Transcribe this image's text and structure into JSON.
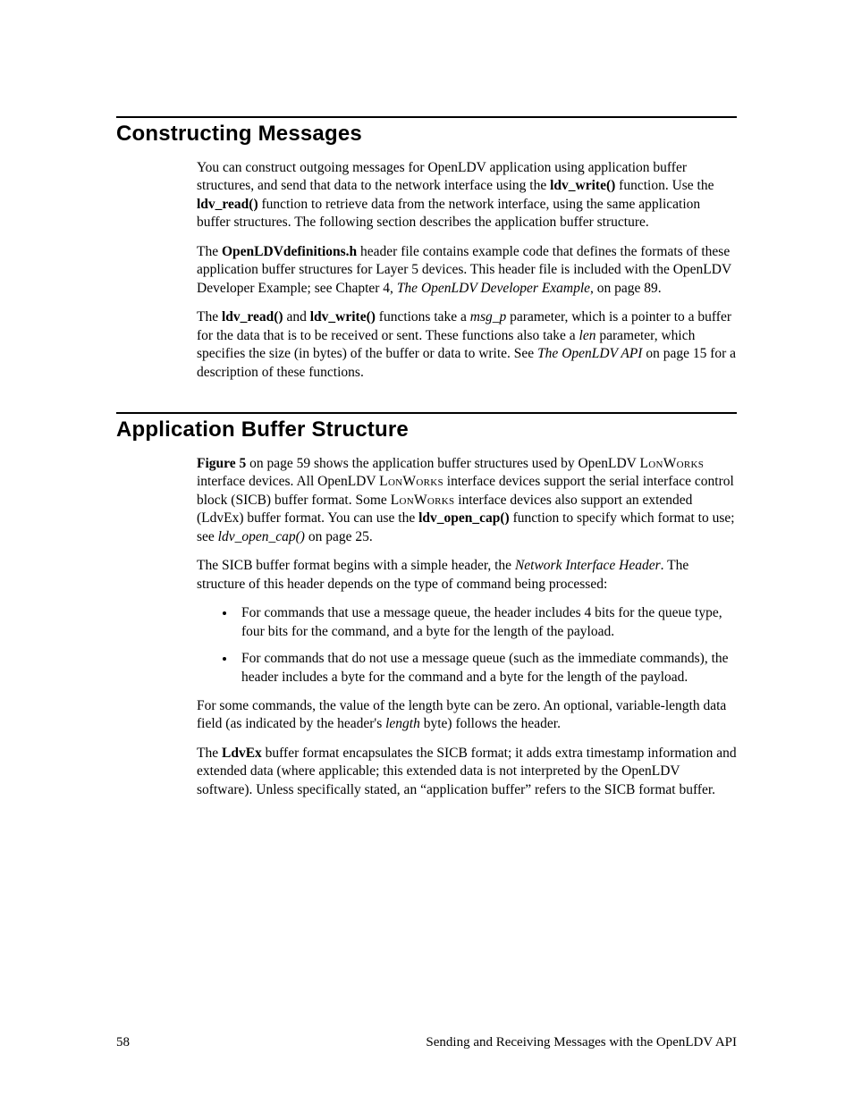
{
  "page_number": "58",
  "footer_text": "Sending and Receiving Messages with the OpenLDV API",
  "sections": {
    "constructing": {
      "heading": "Constructing Messages",
      "p1_a": "You can construct outgoing messages for OpenLDV application using application buffer structures, and send that data to the network interface using the ",
      "p1_ldv_write": "ldv_write()",
      "p1_b": " function.  Use the ",
      "p1_ldv_read": "ldv_read()",
      "p1_c": " function to retrieve data from the network interface, using the same application buffer structures.  The following section describes the application buffer structure.",
      "p2_a": "The ",
      "p2_header": "OpenLDVdefinitions.h",
      "p2_b": " header file contains example code that defines the formats of these application buffer structures for Layer 5 devices.  This header file is included with the OpenLDV Developer Example; see Chapter 4, ",
      "p2_ital": "The OpenLDV Developer Example",
      "p2_c": ", on page 89.",
      "p3_a": "The ",
      "p3_read": "ldv_read()",
      "p3_b": " and ",
      "p3_write": "ldv_write()",
      "p3_c": " functions take a ",
      "p3_msgp": "msg_p",
      "p3_d": " parameter, which is a pointer to a buffer for the data that is to be received or sent.  These functions also take a ",
      "p3_len": "len",
      "p3_e": " parameter, which specifies the size (in bytes) of the buffer or data to write.  See ",
      "p3_api": "The OpenLDV API",
      "p3_f": " on page 15 for a description of these functions."
    },
    "appbuf": {
      "heading": "Application Buffer Structure",
      "p1_a": "Figure 5",
      "p1_b": " on page 59 shows the application buffer structures used by OpenLDV ",
      "p1_lon1": "LonWorks",
      "p1_c": " interface devices.  All OpenLDV ",
      "p1_lon2": "LonWorks",
      "p1_d": " interface devices support the serial interface control block (SICB) buffer format.  Some ",
      "p1_lon3": "LonWorks",
      "p1_e": " interface devices also support an extended (LdvEx) buffer format.  You can use the ",
      "p1_open": "ldv_open_cap()",
      "p1_f": " function to specify which format to use; see ",
      "p1_open_ital": "ldv_open_cap()",
      "p1_g": " on page 25.",
      "p2_a": "The SICB buffer format begins with a simple header, the ",
      "p2_nih": "Network Interface Header",
      "p2_b": ".  The structure of this header depends on the type of command being processed:",
      "li1": "For commands that use a message queue, the header includes 4 bits for the queue type, four bits for the command, and a byte for the length of the payload.",
      "li2": "For commands that do not use a message queue (such as the immediate commands), the header includes a byte for the command and a byte for the length of the payload.",
      "p3_a": "For some commands, the value of the length byte can be zero.  An optional, variable-length data field (as indicated by the header's ",
      "p3_length": "length",
      "p3_b": " byte) follows the header.",
      "p4_a": "The ",
      "p4_ldvex": "LdvEx",
      "p4_b": " buffer format encapsulates the SICB format; it adds extra timestamp information and extended data (where applicable; this extended data is not interpreted by the OpenLDV software).  Unless specifically stated, an “application buffer” refers to the SICB format buffer."
    }
  }
}
